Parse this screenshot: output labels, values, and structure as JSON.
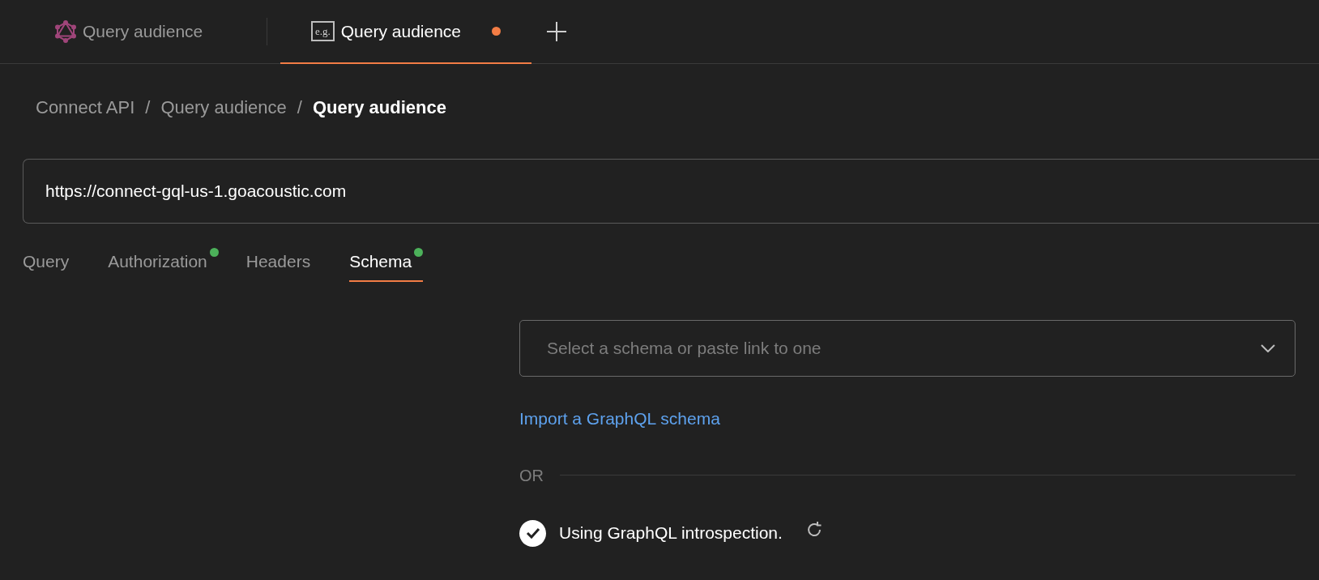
{
  "tabs": [
    {
      "kind": "graphql",
      "label": "Query audience",
      "selected": false,
      "modified": false
    },
    {
      "kind": "example",
      "icon_text": "e.g.",
      "label": "Query audience",
      "selected": true,
      "modified": true
    }
  ],
  "breadcrumb": [
    {
      "label": "Connect API",
      "current": false
    },
    {
      "label": "Query audience",
      "current": false
    },
    {
      "label": "Query audience",
      "current": true
    }
  ],
  "breadcrumb_separator": "/",
  "url": "https://connect-gql-us-1.goacoustic.com",
  "request_tabs": [
    {
      "label": "Query",
      "selected": false,
      "indicator": false
    },
    {
      "label": "Authorization",
      "selected": false,
      "indicator": true
    },
    {
      "label": "Headers",
      "selected": false,
      "indicator": false
    },
    {
      "label": "Schema",
      "selected": true,
      "indicator": true
    }
  ],
  "schema": {
    "select": {
      "placeholder": "Select a schema or paste link to one"
    },
    "import_link": "Import a GraphQL schema",
    "divider_label": "OR",
    "introspection": {
      "label": "Using GraphQL introspection.",
      "checked": true
    }
  }
}
